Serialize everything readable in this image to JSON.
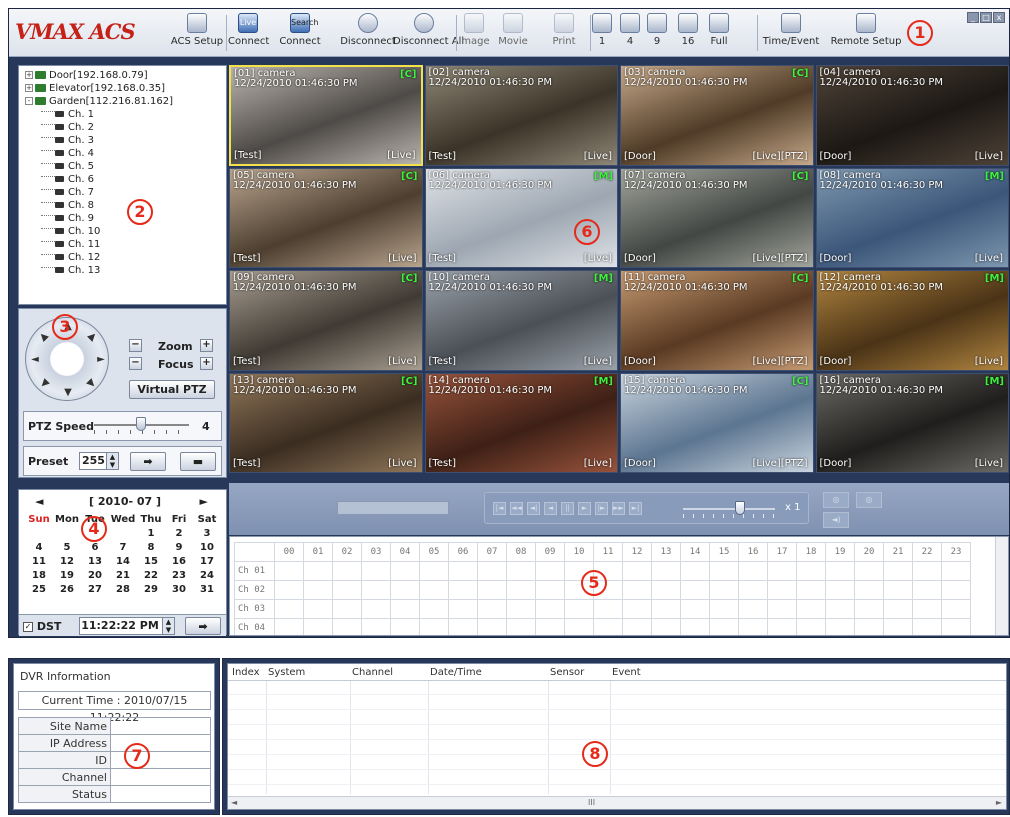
{
  "app": {
    "logo": "VMAX ACS"
  },
  "toolbar": {
    "buttons": [
      {
        "label": "ACS Setup",
        "icon": "gear-icon"
      },
      {
        "label": "Connect",
        "icon": "live-icon",
        "top": "Live"
      },
      {
        "label": "Connect",
        "icon": "search-icon",
        "top": "Search"
      },
      {
        "label": "Disconnect",
        "icon": "disconnect-icon"
      },
      {
        "label": "Disconnect All",
        "icon": "disconnect-all-icon"
      },
      {
        "label": "Image",
        "icon": "image-icon"
      },
      {
        "label": "Movie",
        "icon": "movie-icon"
      },
      {
        "label": "Print",
        "icon": "print-icon"
      },
      {
        "label": "1",
        "icon": "layout-1-icon"
      },
      {
        "label": "4",
        "icon": "layout-4-icon"
      },
      {
        "label": "9",
        "icon": "layout-9-icon"
      },
      {
        "label": "16",
        "icon": "layout-16-icon"
      },
      {
        "label": "Full",
        "icon": "fullscreen-icon"
      },
      {
        "label": "Time/Event",
        "icon": "time-event-icon"
      },
      {
        "label": "Remote Setup",
        "icon": "remote-setup-icon"
      }
    ]
  },
  "callouts": [
    "1",
    "2",
    "3",
    "4",
    "5",
    "6",
    "7",
    "8"
  ],
  "tree": {
    "devices": [
      {
        "name": "Door[192.168.0.79]",
        "expander": "+"
      },
      {
        "name": "Elevator[192.168.0.35]",
        "expander": "+"
      },
      {
        "name": "Garden[112.216.81.162]",
        "expander": "-"
      }
    ],
    "channels": [
      "Ch. 1",
      "Ch. 2",
      "Ch. 3",
      "Ch. 4",
      "Ch. 5",
      "Ch. 6",
      "Ch. 7",
      "Ch. 8",
      "Ch. 9",
      "Ch. 10",
      "Ch. 11",
      "Ch. 12",
      "Ch. 13"
    ]
  },
  "ptz": {
    "zoom_label": "Zoom",
    "focus_label": "Focus",
    "virtual_label": "Virtual PTZ",
    "speed_label": "PTZ Speed",
    "speed_value": "4",
    "preset_label": "Preset",
    "preset_value": "255",
    "minus": "−",
    "plus": "+"
  },
  "cameras": [
    {
      "title": "[01] camera",
      "time": "12/24/2010 01:46:30 PM",
      "badge": "[C]",
      "bl": "[Test]",
      "br": "[Live]",
      "colors": [
        "#4e4a47",
        "#b9b4ad"
      ]
    },
    {
      "title": "[02] camera",
      "time": "12/24/2010 01:46:30 PM",
      "badge": "",
      "bl": "[Test]",
      "br": "[Live]",
      "colors": [
        "#3b3327",
        "#8e8777"
      ]
    },
    {
      "title": "[03] camera",
      "time": "12/24/2010 01:46:30 PM",
      "badge": "[C]",
      "bl": "[Door]",
      "br": "[Live][PTZ]",
      "colors": [
        "#4f3b27",
        "#c6a98a"
      ]
    },
    {
      "title": "[04] camera",
      "time": "12/24/2010 01:46:30 PM",
      "badge": "",
      "bl": "[Door]",
      "br": "[Live]",
      "colors": [
        "#1c1814",
        "#4f4338"
      ]
    },
    {
      "title": "[05] camera",
      "time": "12/24/2010 01:46:30 PM",
      "badge": "[C]",
      "bl": "[Test]",
      "br": "[Live]",
      "colors": [
        "#4d3e2f",
        "#b8a58f"
      ]
    },
    {
      "title": "[06] camera",
      "time": "12/24/2010 01:46:30 PM",
      "badge": "[M]",
      "bl": "[Test]",
      "br": "[Live]",
      "colors": [
        "#9da6b1",
        "#dfe3e7"
      ]
    },
    {
      "title": "[07] camera",
      "time": "12/24/2010 01:46:30 PM",
      "badge": "[C]",
      "bl": "[Door]",
      "br": "[Live][PTZ]",
      "colors": [
        "#434744",
        "#a2a59c"
      ]
    },
    {
      "title": "[08] camera",
      "time": "12/24/2010 01:46:30 PM",
      "badge": "[M]",
      "bl": "[Door]",
      "br": "[Live]",
      "colors": [
        "#3b5679",
        "#7e98b0"
      ]
    },
    {
      "title": "[09] camera",
      "time": "12/24/2010 01:46:30 PM",
      "badge": "[C]",
      "bl": "[Test]",
      "br": "[Live]",
      "colors": [
        "#3f3a33",
        "#a79d90"
      ]
    },
    {
      "title": "[10] camera",
      "time": "12/24/2010 01:46:30 PM",
      "badge": "[M]",
      "bl": "[Test]",
      "br": "[Live]",
      "colors": [
        "#4b5056",
        "#9aa1a9"
      ]
    },
    {
      "title": "[11] camera",
      "time": "12/24/2010 01:46:30 PM",
      "badge": "[C]",
      "bl": "[Door]",
      "br": "[Live][PTZ]",
      "colors": [
        "#5a3a22",
        "#c59a72"
      ]
    },
    {
      "title": "[12] camera",
      "time": "12/24/2010 01:46:30 PM",
      "badge": "[M]",
      "bl": "[Door]",
      "br": "[Live]",
      "colors": [
        "#4a3316",
        "#b0843f"
      ]
    },
    {
      "title": "[13] camera",
      "time": "12/24/2010 01:46:30 PM",
      "badge": "[C]",
      "bl": "[Test]",
      "br": "[Live]",
      "colors": [
        "#3a2d21",
        "#907659"
      ]
    },
    {
      "title": "[14] camera",
      "time": "12/24/2010 01:46:30 PM",
      "badge": "[M]",
      "bl": "[Test]",
      "br": "[Live]",
      "colors": [
        "#3e2016",
        "#97533b"
      ]
    },
    {
      "title": "[15] camera",
      "time": "12/24/2010 01:46:30 PM",
      "badge": "[C]",
      "bl": "[Door]",
      "br": "[Live][PTZ]",
      "colors": [
        "#5c7590",
        "#c9d4de"
      ]
    },
    {
      "title": "[16] camera",
      "time": "12/24/2010 01:46:30 PM",
      "badge": "[M]",
      "bl": "[Door]",
      "br": "[Live]",
      "colors": [
        "#1f1e1c",
        "#6b6a66"
      ]
    }
  ],
  "calendar": {
    "prev": "◄",
    "next": "►",
    "month": "[ 2010- 07 ]",
    "weekdays": [
      "Sun",
      "Mon",
      "Tue",
      "Wed",
      "Thu",
      "Fri",
      "Sat"
    ],
    "weeks": [
      [
        "",
        "",
        "",
        "",
        "1",
        "2",
        "3"
      ],
      [
        "4",
        "5",
        "6",
        "7",
        "8",
        "9",
        "10"
      ],
      [
        "11",
        "12",
        "13",
        "14",
        "15",
        "16",
        "17"
      ],
      [
        "18",
        "19",
        "20",
        "21",
        "22",
        "23",
        "24"
      ],
      [
        "25",
        "26",
        "27",
        "28",
        "29",
        "30",
        "31"
      ]
    ],
    "dst_label": "DST",
    "time_value": "11:22:22 PM"
  },
  "playback": {
    "speed": "x 1"
  },
  "timeline": {
    "hours": [
      "00",
      "01",
      "02",
      "03",
      "04",
      "05",
      "06",
      "07",
      "08",
      "09",
      "10",
      "11",
      "12",
      "13",
      "14",
      "15",
      "16",
      "17",
      "18",
      "19",
      "20",
      "21",
      "22",
      "23"
    ],
    "channels": [
      "Ch 01",
      "Ch 02",
      "Ch 03",
      "Ch 04"
    ]
  },
  "dvr": {
    "title": "DVR Information",
    "current_time": "Current Time : 2010/07/15 11:22:22",
    "fields": [
      {
        "label": "Site Name",
        "value": ""
      },
      {
        "label": "IP Address",
        "value": ""
      },
      {
        "label": "ID",
        "value": ""
      },
      {
        "label": "Channel",
        "value": ""
      },
      {
        "label": "Status",
        "value": ""
      }
    ]
  },
  "log": {
    "columns": [
      "Index",
      "System",
      "Channel",
      "Date/Time",
      "Sensor",
      "Event"
    ],
    "scroll_label": "III"
  }
}
